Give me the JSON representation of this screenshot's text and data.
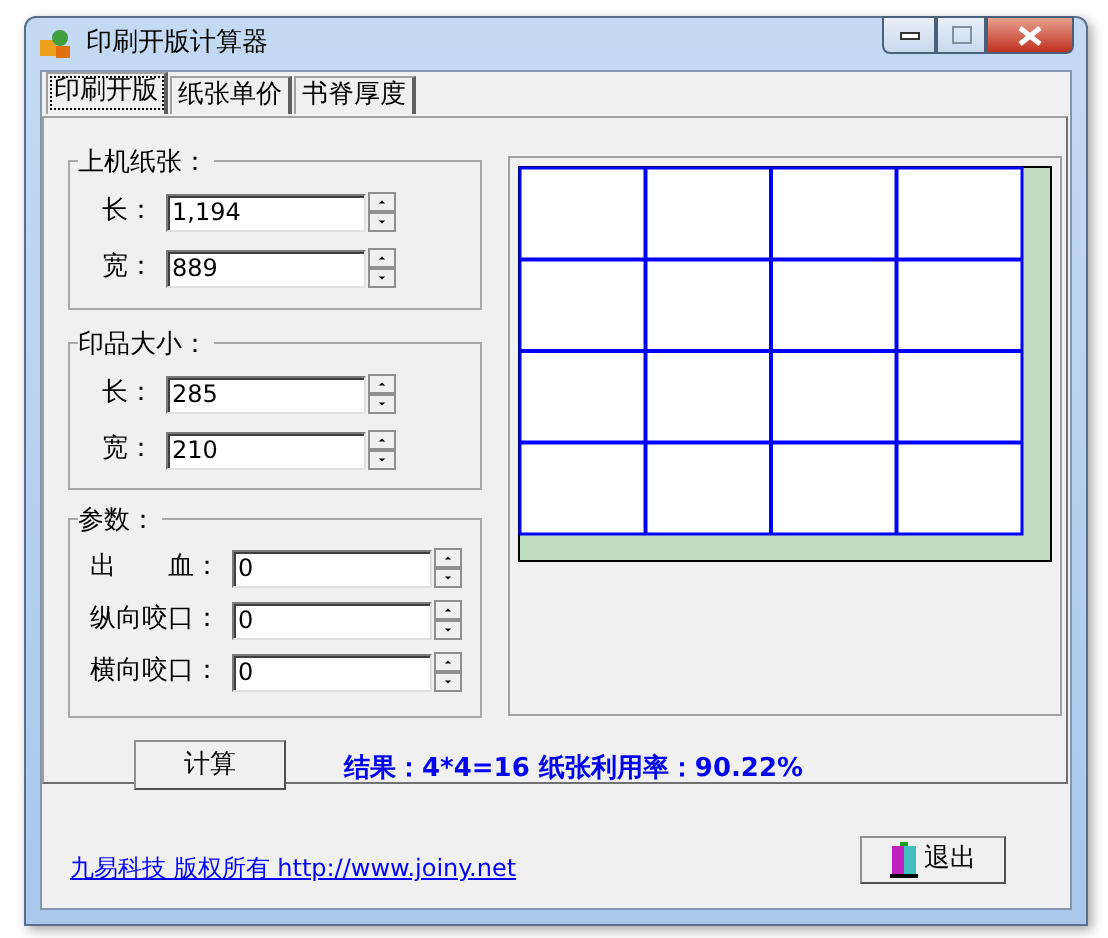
{
  "window": {
    "title": "印刷开版计算器"
  },
  "tabs": [
    {
      "label": "印刷开版",
      "selected": true
    },
    {
      "label": "纸张单价",
      "selected": false
    },
    {
      "label": "书脊厚度",
      "selected": false
    }
  ],
  "groups": [
    {
      "title": "上机纸张：",
      "kind": "short",
      "fields": [
        {
          "label": "长：",
          "value": "1,194"
        },
        {
          "label": "宽：",
          "value": "889"
        }
      ]
    },
    {
      "title": "印品大小：",
      "kind": "short",
      "fields": [
        {
          "label": "长：",
          "value": "285"
        },
        {
          "label": "宽：",
          "value": "210"
        }
      ]
    },
    {
      "title": "参数：",
      "kind": "wide",
      "fields": [
        {
          "label": "出　　血：",
          "value": "0"
        },
        {
          "label": "纵向咬口：",
          "value": "0"
        },
        {
          "label": "横向咬口：",
          "value": "0"
        }
      ]
    }
  ],
  "calculate_button": "计算",
  "result": "结果：4*4=16  纸张利用率：90.22%",
  "footer": {
    "copyright": "九易科技 版权所有 http://www.joiny.net",
    "exit_button": "退出"
  }
}
